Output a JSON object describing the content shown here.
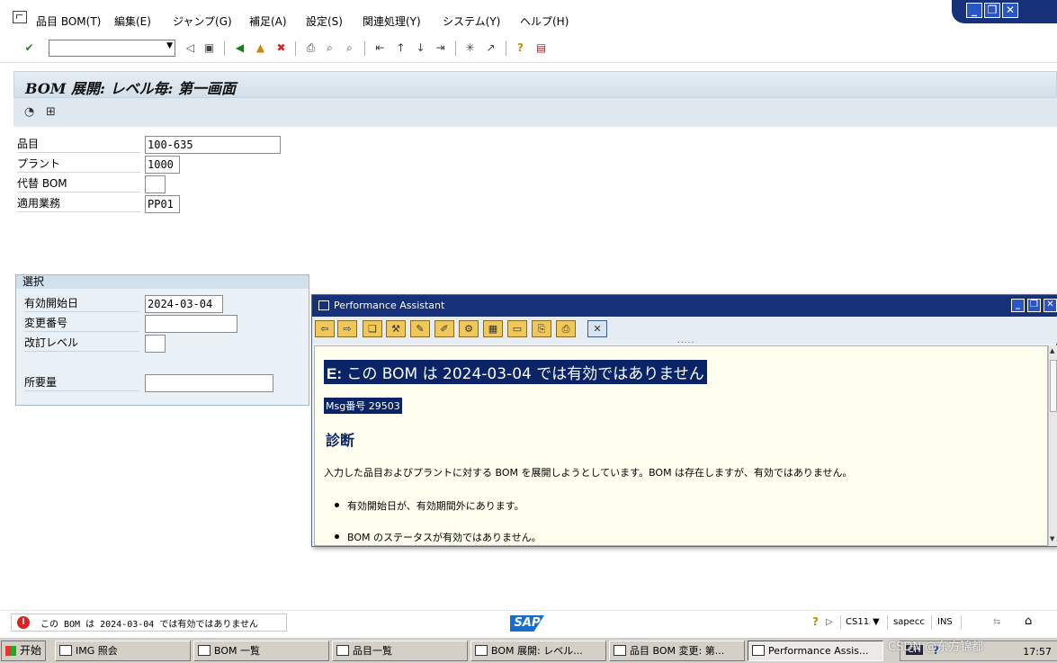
{
  "menu": {
    "items": [
      "品目 BOM(T)",
      "編集(E)",
      "ジャンプ(G)",
      "補足(A)",
      "設定(S)",
      "関連処理(Y)",
      "システム(Y)",
      "ヘルプ(H)"
    ]
  },
  "window_controls": {
    "minimize": "_",
    "restore": "❐",
    "close": "✕"
  },
  "toolbar": {
    "command_field_value": "",
    "icons": [
      "enter-icon",
      "back-icon",
      "save-icon",
      "exit-icon",
      "cancel-icon",
      "print-icon",
      "find-icon",
      "find-next-icon",
      "first-page-icon",
      "prev-page-icon",
      "next-page-icon",
      "last-page-icon",
      "new-session-icon",
      "shortcut-icon",
      "help-icon",
      "layout-icon"
    ]
  },
  "page": {
    "title": "BOM 展開: レベル毎: 第一画面"
  },
  "form": {
    "material_label": "品目",
    "material_value": "100-635",
    "plant_label": "プラント",
    "plant_value": "1000",
    "alt_bom_label": "代替 BOM",
    "alt_bom_value": "",
    "application_label": "適用業務",
    "application_value": "PP01"
  },
  "selection": {
    "title": "選択",
    "valid_from_label": "有効開始日",
    "valid_from_value": "2024-03-04",
    "change_no_label": "変更番号",
    "change_no_value": "",
    "revision_label": "改訂レベル",
    "revision_value": "",
    "required_qty_label": "所要量",
    "required_qty_value": ""
  },
  "assistant": {
    "title": "Performance Assistant",
    "message_prefix": "E:",
    "message_text": " この BOM は 2024-03-04 では有効ではありません",
    "msg_number": "Msg番号 29503",
    "diagnosis_heading": "診断",
    "diagnosis_text": "入力した品目およびプラントに対する BOM を展開しようとしています。BOM は存在しますが、有効ではありません。",
    "bullet1": "有効開始日が、有効期間外にあります。",
    "bullet2": "BOM のステータスが有効ではありません。"
  },
  "status": {
    "message": "この BOM は 2024-03-04 では有効ではありません",
    "transaction": "CS11",
    "server": "sapecc",
    "mode": "INS"
  },
  "taskbar": {
    "start": "开始",
    "tasks": [
      "IMG 照会",
      "BOM 一覧",
      "品目一覧",
      "BOM 展開: レベル...",
      "品目 BOM 変更: 第...",
      "Performance Assis..."
    ],
    "time": "17:57",
    "watermark": "CSDN @东方锦都"
  }
}
